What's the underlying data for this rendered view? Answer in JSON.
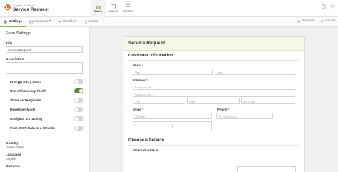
{
  "app": {
    "brand": "Cognito Solutions",
    "form_title": "Service Request"
  },
  "mode_tabs": [
    {
      "label": "BUILD",
      "icon": "build-icon",
      "active": true
    },
    {
      "label": "PUBLISH",
      "icon": "publish-icon",
      "active": false
    },
    {
      "label": "ENTRIES",
      "icon": "entries-icon",
      "active": false
    }
  ],
  "subtabs": [
    {
      "label": "Settings",
      "active": true
    },
    {
      "label": "Payment",
      "active": false
    },
    {
      "label": "Workflow",
      "active": false
    },
    {
      "label": "Users",
      "active": false
    }
  ],
  "toolbar": {
    "preview": "Preview",
    "saved": "Saved"
  },
  "settings": {
    "heading": "Form Settings",
    "title_label": "Title",
    "title_value": "Service Request",
    "description_label": "Description",
    "options": [
      {
        "prefix": "",
        "label": "Encrypt Entry Data?",
        "toggle": false
      },
      {
        "prefix": "",
        "label": "Use with Lookup Field?",
        "toggle": true
      },
      {
        "prefix": "›",
        "label": "Share as Template?",
        "toggle": false
      },
      {
        "prefix": "›",
        "label": "Developer Mode",
        "toggle": false
      },
      {
        "prefix": "›",
        "label": "Analytics & Tracking",
        "toggle": false
      },
      {
        "prefix": "›",
        "label": "Post JSON Data to a Website",
        "toggle": false
      }
    ],
    "country_label": "Country",
    "country_value": "United States",
    "language_label": "Language",
    "language_value": "English",
    "currency_label": "Currency"
  },
  "form": {
    "header": "Service Request",
    "customer_section": "Customer Information",
    "name_label": "Name",
    "first_placeholder": "First",
    "last_placeholder": "Last",
    "address_label": "Address",
    "address1_placeholder": "Address Line 1",
    "address2_placeholder": "Address Line 2",
    "city_placeholder": "City",
    "state_placeholder": "State",
    "zip_placeholder": "Zip Code",
    "email_label": "Email",
    "email_placeholder": "Email",
    "phone_label": "Phone",
    "phone_placeholder": "Phone (US)",
    "add_symbol": "+",
    "service_section": "Choose a Service",
    "issue_label": "Select Your Issue"
  },
  "colors": {
    "accent": "#88b04b",
    "toggle_on": "#5f8a3e",
    "header_bg": "#f4f8e9",
    "required": "#c0392b"
  }
}
